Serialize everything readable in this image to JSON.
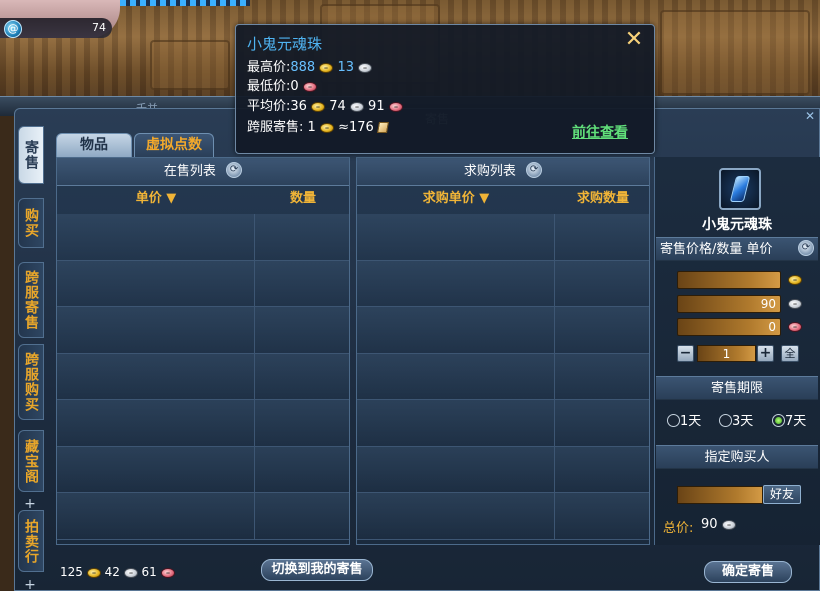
{
  "player": {
    "level": "74"
  },
  "window": {
    "back_title": "千并",
    "title": "寄售",
    "close_icon": "×"
  },
  "side_tabs": [
    {
      "label": "寄售",
      "active": true
    },
    {
      "label": "购买",
      "active": false
    },
    {
      "label": "跨服寄售",
      "active": false
    },
    {
      "label": "跨服购买",
      "active": false
    },
    {
      "label": "藏宝阁",
      "active": false
    },
    {
      "label": "拍卖行",
      "active": false
    }
  ],
  "top_tabs": [
    {
      "label": "物品",
      "active": true
    },
    {
      "label": "虚拟点数",
      "active": false
    }
  ],
  "sale_list": {
    "title": "在售列表",
    "col_price": "单价 ▼",
    "col_qty": "数量"
  },
  "buy_list": {
    "title": "求购列表",
    "col_price": "求购单价 ▼",
    "col_qty": "求购数量"
  },
  "tooltip": {
    "title": "小鬼元魂珠",
    "max_label": "最高价:",
    "max_gold": "888",
    "max_silver": "13",
    "min_label": "最低价:",
    "min_copper": "0",
    "avg_label": "平均价:",
    "avg_gold": "36",
    "avg_silver": "74",
    "avg_copper": "91",
    "cross_label": "跨服寄售: ",
    "cross_gold": "1",
    "cross_approx": "≈176",
    "link": "前往查看",
    "close": "✕"
  },
  "right": {
    "item_name": "小鬼元魂珠",
    "price_header": "寄售价格/数量  单价",
    "gold_value": "",
    "silver_value": "90",
    "copper_value": "0",
    "qty_minus": "−",
    "qty_value": "1",
    "qty_plus": "+",
    "qty_all": "全",
    "period_header": "寄售期限",
    "period_options": [
      {
        "label": "1天",
        "selected": false
      },
      {
        "label": "3天",
        "selected": false
      },
      {
        "label": "7天",
        "selected": true
      }
    ],
    "buyer_header": "指定购买人",
    "friend_button": "好友",
    "total_label": "总价:",
    "total_value": "90"
  },
  "bottom": {
    "wallet_gold": "125",
    "wallet_silver": "42",
    "wallet_copper": "61",
    "switch_button": "切换到我的寄售",
    "confirm_button": "确定寄售"
  },
  "colors": {
    "accent_orange": "#f0b437",
    "title_blue": "#4fb4f2",
    "link_green": "#61e07a"
  }
}
